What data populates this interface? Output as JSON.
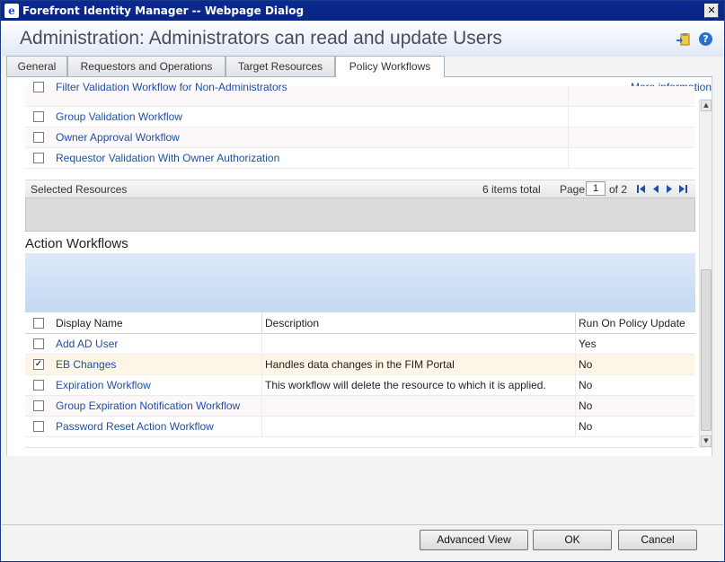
{
  "window": {
    "title": "Forefront Identity Manager -- Webpage Dialog",
    "close_glyph": "✕"
  },
  "header": {
    "page_title": "Administration: Administrators can read and update Users",
    "help_glyph": "?"
  },
  "tabs": [
    {
      "label": "General"
    },
    {
      "label": "Requestors and Operations"
    },
    {
      "label": "Target Resources"
    },
    {
      "label": "Policy Workflows",
      "active": true
    }
  ],
  "content": {
    "more_information": "More information",
    "auth_workflows": [
      {
        "name": "Filter Validation Workflow for Non-Administrators",
        "checked": false
      },
      {
        "name": "Group Validation Workflow",
        "checked": false
      },
      {
        "name": "Owner Approval Workflow",
        "checked": false
      },
      {
        "name": "Requestor Validation With Owner Authorization",
        "checked": false
      }
    ],
    "selected_resources": {
      "title": "Selected Resources",
      "count": "6 items total",
      "page_label": "Page",
      "page_value": "1",
      "page_of": "of 2"
    },
    "action_workflows": {
      "title": "Action Workflows",
      "columns": [
        "Display Name",
        "Description",
        "Run On Policy Update"
      ],
      "rows": [
        {
          "name": "Add AD User",
          "description": "",
          "run": "Yes",
          "checked": false
        },
        {
          "name": "EB Changes",
          "description": "Handles data changes in the FIM Portal",
          "run": "No",
          "checked": true
        },
        {
          "name": "Expiration Workflow",
          "description": "This workflow will delete the resource to which it is applied.",
          "run": "No",
          "checked": false
        },
        {
          "name": "Group Expiration Notification Workflow",
          "description": "",
          "run": "No",
          "checked": false
        },
        {
          "name": "Password Reset Action Workflow",
          "description": "",
          "run": "No",
          "checked": false
        }
      ]
    }
  },
  "footer": {
    "advanced_view": "Advanced View",
    "ok": "OK",
    "cancel": "Cancel"
  },
  "colors": {
    "titlebar": "#0b2a8f",
    "link": "#1f4fa3",
    "selected_row": "#fdf5e6"
  }
}
